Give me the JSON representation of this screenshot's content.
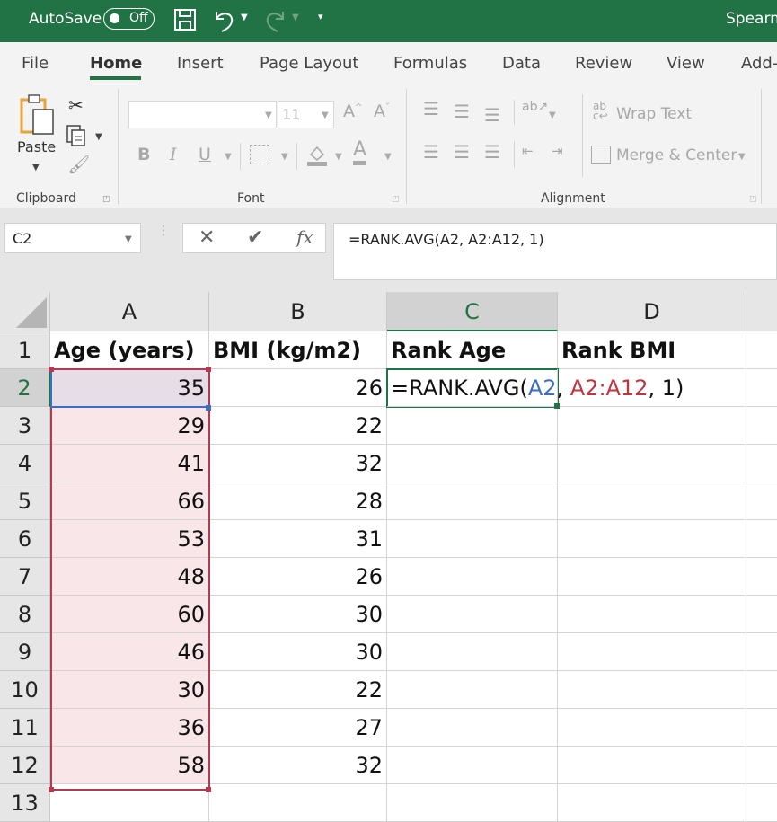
{
  "titlebar": {
    "autosave_label": "AutoSave",
    "autosave_state": "Off",
    "title": "Spearm",
    "icons": [
      "save-icon",
      "undo-icon",
      "redo-icon",
      "customize-qat-icon"
    ]
  },
  "tabs": [
    {
      "label": "File"
    },
    {
      "label": "Home",
      "active": true
    },
    {
      "label": "Insert"
    },
    {
      "label": "Page Layout"
    },
    {
      "label": "Formulas"
    },
    {
      "label": "Data"
    },
    {
      "label": "Review"
    },
    {
      "label": "View"
    },
    {
      "label": "Add-"
    }
  ],
  "ribbon": {
    "clipboard": {
      "label": "Clipboard",
      "paste": "Paste"
    },
    "font": {
      "label": "Font",
      "font_name": "",
      "font_size": "11",
      "bold": "B",
      "italic": "I",
      "underline": "U"
    },
    "alignment": {
      "label": "Alignment",
      "wrap_text": "Wrap Text",
      "merge_center": "Merge & Center"
    }
  },
  "formula_bar": {
    "name_box": "C2",
    "formula": "=RANK.AVG(A2, A2:A12, 1)",
    "fx": "fx"
  },
  "sheet": {
    "columns": [
      "A",
      "B",
      "C",
      "D"
    ],
    "selected_column": "C",
    "selected_row": "2",
    "rows": [
      {
        "n": "1",
        "a": "Age (years)",
        "b": "BMI (kg/m2)",
        "c": "Rank Age",
        "d": "Rank BMI"
      },
      {
        "n": "2",
        "a": "35",
        "b": "26"
      },
      {
        "n": "3",
        "a": "29",
        "b": "22"
      },
      {
        "n": "4",
        "a": "41",
        "b": "32"
      },
      {
        "n": "5",
        "a": "66",
        "b": "28"
      },
      {
        "n": "6",
        "a": "53",
        "b": "31"
      },
      {
        "n": "7",
        "a": "48",
        "b": "26"
      },
      {
        "n": "8",
        "a": "60",
        "b": "30"
      },
      {
        "n": "9",
        "a": "46",
        "b": "30"
      },
      {
        "n": "10",
        "a": "30",
        "b": "22"
      },
      {
        "n": "11",
        "a": "36",
        "b": "27"
      },
      {
        "n": "12",
        "a": "58",
        "b": "32"
      },
      {
        "n": "13",
        "a": "",
        "b": ""
      }
    ],
    "edit_cell": {
      "prefix": "=RANK.AVG(",
      "ref1": "A2",
      "sep1": ", ",
      "ref2": "A2:A12",
      "suffix": ", 1)"
    }
  },
  "colors": {
    "brand": "#217346",
    "ref_blue": "#3a6fc4",
    "ref_red": "#c0343d"
  }
}
